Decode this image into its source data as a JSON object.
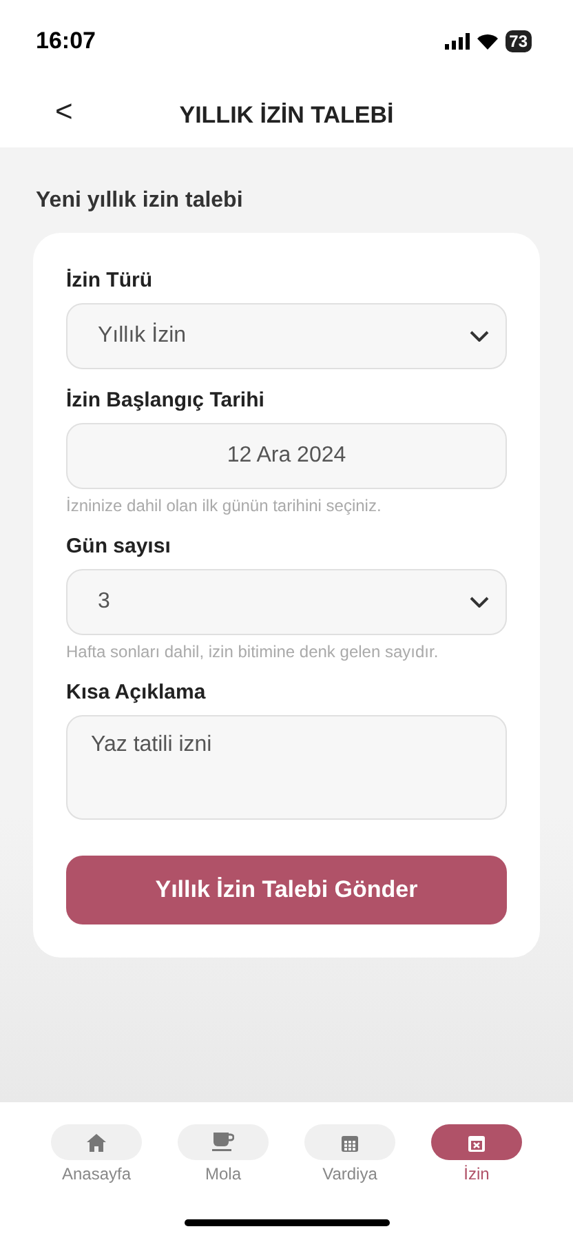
{
  "status_bar": {
    "time": "16:07",
    "battery": "73"
  },
  "header": {
    "back": "<",
    "title": "YILLIK İZİN TALEBİ"
  },
  "section_title": "Yeni yıllık izin talebi",
  "fields": [
    {
      "kind": "select",
      "label": "İzin Türü",
      "value": "Yıllık İzin"
    },
    {
      "kind": "date",
      "label": "İzin Başlangıç Tarihi",
      "value": "12 Ara 2024",
      "hint": "İzninize dahil olan ilk günün tarihini seçiniz."
    },
    {
      "kind": "select",
      "label": "Gün sayısı",
      "value": "3",
      "hint": "Hafta sonları dahil, izin bitimine denk gelen sayıdır."
    },
    {
      "kind": "textarea",
      "label": "Kısa Açıklama",
      "value": "Yaz tatili izni"
    }
  ],
  "submit_button": "Yıllık İzin Talebi Gönder",
  "nav": [
    {
      "kind": "home",
      "label": "Anasayfa",
      "selected": false
    },
    {
      "kind": "cup",
      "label": "Mola",
      "selected": false
    },
    {
      "kind": "calendar",
      "label": "Vardiya",
      "selected": false
    },
    {
      "kind": "calendar-x",
      "label": "İzin",
      "selected": true
    }
  ]
}
